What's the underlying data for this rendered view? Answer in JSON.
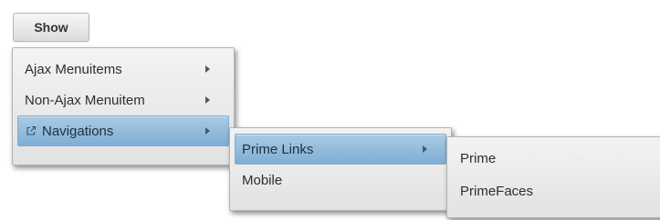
{
  "show_button": {
    "label": "Show"
  },
  "menu_root": {
    "items": [
      {
        "label": "Ajax Menuitems",
        "has_submenu": true
      },
      {
        "label": "Non-Ajax Menuitem",
        "has_submenu": true
      },
      {
        "label": "Navigations",
        "has_submenu": true,
        "icon": "external-link-icon",
        "active": true
      }
    ]
  },
  "menu_navigations": {
    "items": [
      {
        "label": "Prime Links",
        "has_submenu": true,
        "active": true
      },
      {
        "label": "Mobile",
        "has_submenu": false
      }
    ]
  },
  "menu_prime_links": {
    "items": [
      {
        "label": "Prime"
      },
      {
        "label": "PrimeFaces"
      }
    ]
  },
  "colors": {
    "active_item_top": "#a9cbe4",
    "active_item_bottom": "#7faed4",
    "menu_bg": "#ececec"
  }
}
